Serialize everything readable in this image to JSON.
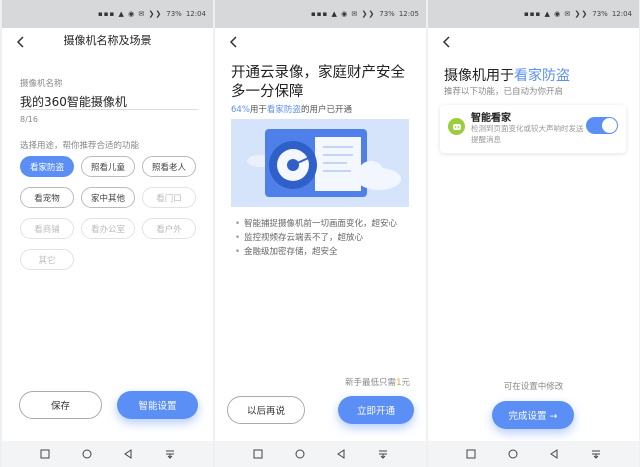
{
  "status": {
    "battery": "73%",
    "time_1": "12:04",
    "time_2": "12:05",
    "time_3": "12:04",
    "icons": "▪▪▪ ▲ ◉ ✉ ❯❯"
  },
  "screen1": {
    "title": "摄像机名称及场景",
    "name_label": "摄像机名称",
    "name_value": "我的360智能摄像机",
    "counter": "8/16",
    "purpose_label": "选择用途，帮你推荐合适的功能",
    "chips": [
      {
        "label": "看家防盗",
        "state": "selected"
      },
      {
        "label": "照看儿童",
        "state": "normal"
      },
      {
        "label": "照看老人",
        "state": "normal"
      },
      {
        "label": "看宠物",
        "state": "normal"
      },
      {
        "label": "家中其他",
        "state": "normal"
      },
      {
        "label": "看门口",
        "state": "disabled"
      },
      {
        "label": "看商铺",
        "state": "disabled"
      },
      {
        "label": "看办公室",
        "state": "disabled"
      },
      {
        "label": "看户外",
        "state": "disabled"
      },
      {
        "label": "其它",
        "state": "disabled"
      }
    ],
    "save_button": "保存",
    "smart_button": "智能设置"
  },
  "screen2": {
    "title": "开通云录像，家庭财产安全多一分保障",
    "stat_pct": "64%",
    "stat_mid": "用于",
    "stat_scene": "看家防盗",
    "stat_tail": "的用户已开通",
    "bullets": [
      "智能捕捉摄像机前一切画面变化，超安心",
      "监控视频存云端丢不了，超放心",
      "金融级加密存储，超安全"
    ],
    "promo_prefix": "新手最低只需",
    "promo_amount": "1",
    "promo_suffix": "元",
    "later_button": "以后再说",
    "open_button": "立即开通"
  },
  "screen3": {
    "title_prefix": "摄像机用于",
    "title_scene": "看家防盗",
    "subtitle": "推荐以下功能，已自动为你开启",
    "feature_name": "智能看家",
    "feature_desc": "检测到页面变化或较大声响时发送提醒消息",
    "feature_enabled": true,
    "hint": "可在设置中修改",
    "finish_button": "完成设置 →"
  },
  "colors": {
    "accent": "#5b8ff5",
    "feature_icon": "#9ccd3d",
    "promo": "#e3a03a",
    "statusbar": "#d7d8da"
  }
}
